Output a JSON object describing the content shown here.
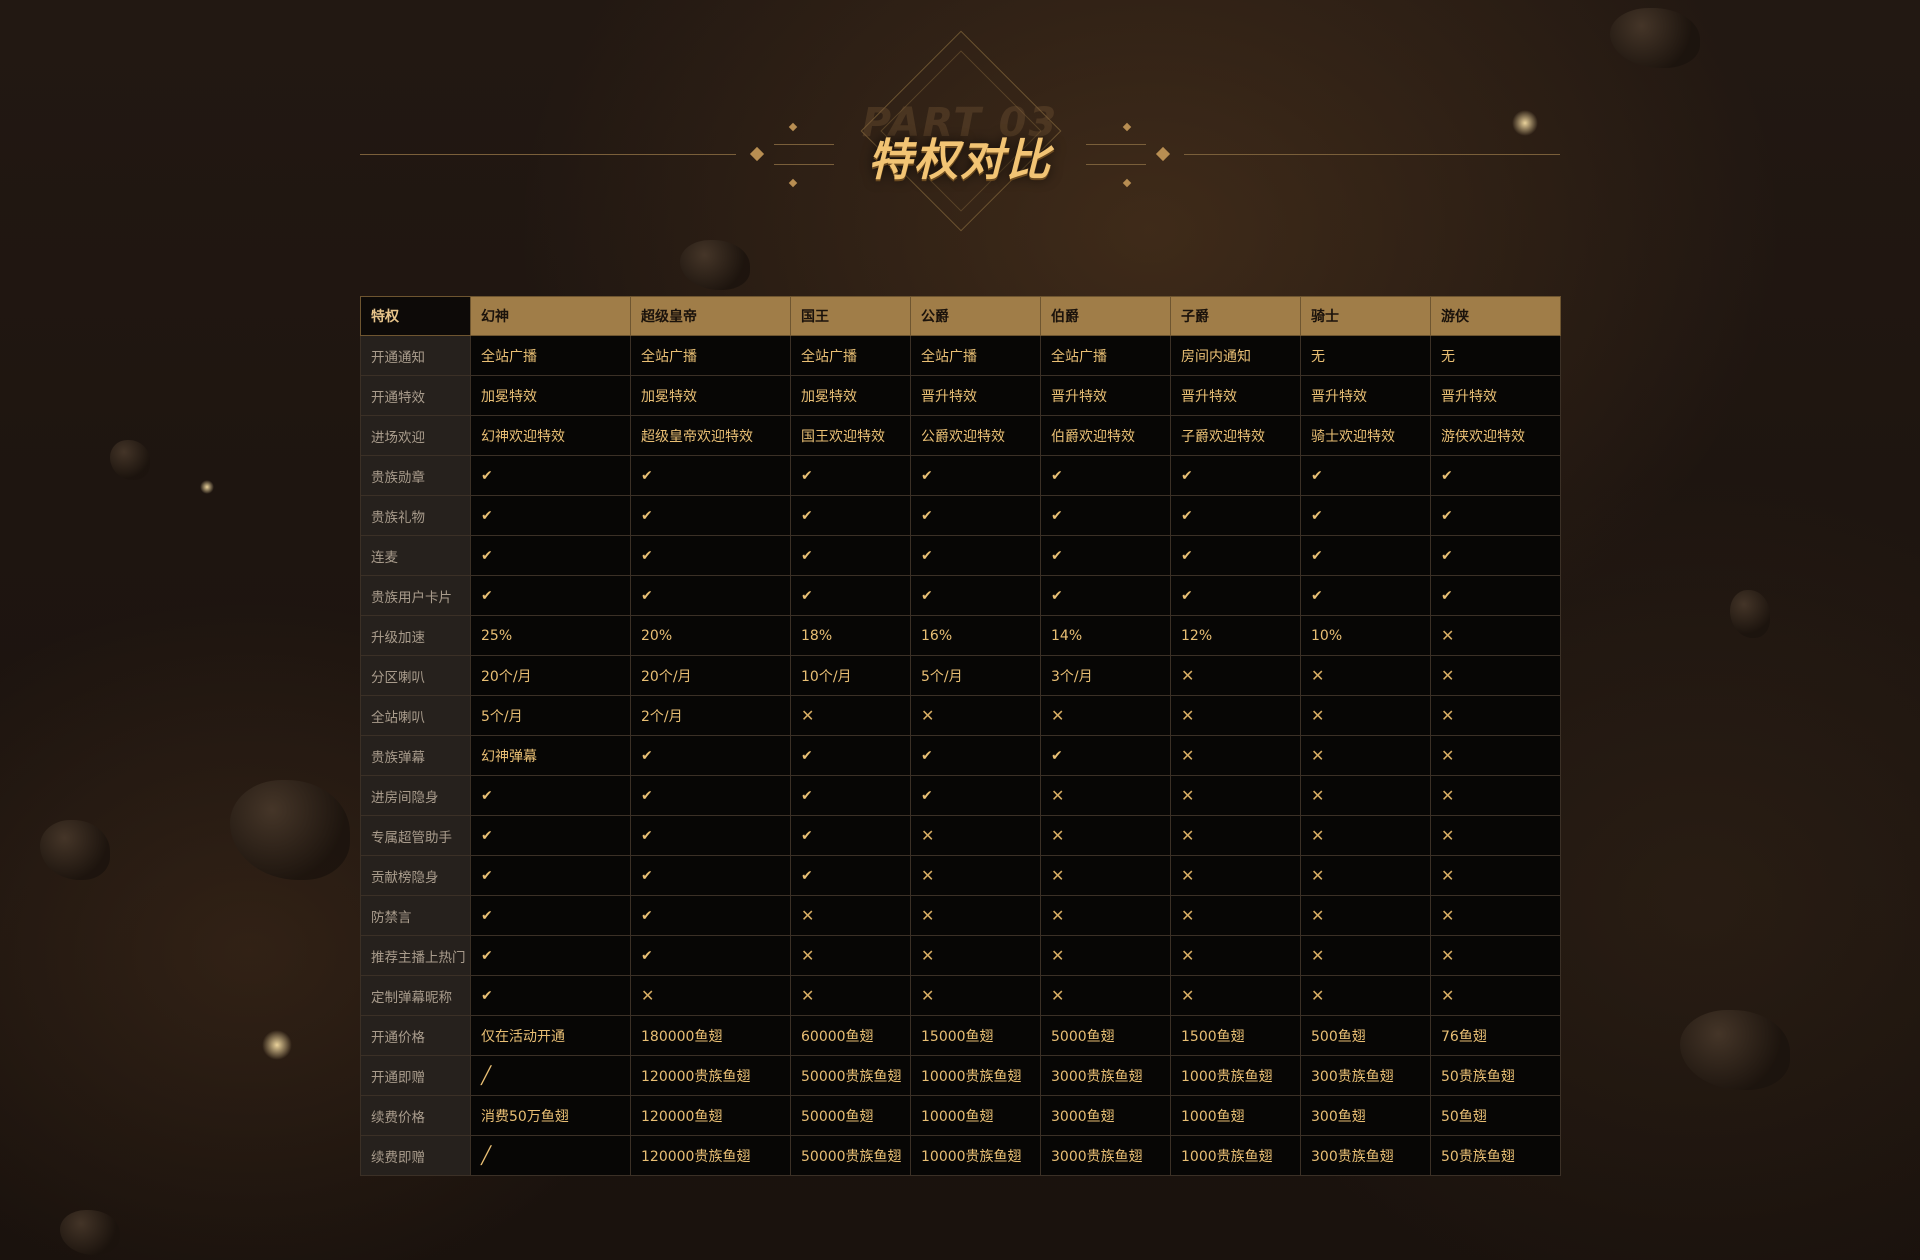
{
  "header": {
    "part_label": "PART 03",
    "title": "特权对比"
  },
  "table": {
    "corner": "特权",
    "columns": [
      "幻神",
      "超级皇帝",
      "国王",
      "公爵",
      "伯爵",
      "子爵",
      "骑士",
      "游侠"
    ],
    "rows": [
      {
        "label": "开通通知",
        "cells": [
          "全站广播",
          "全站广播",
          "全站广播",
          "全站广播",
          "全站广播",
          "房间内通知",
          "无",
          "无"
        ]
      },
      {
        "label": "开通特效",
        "cells": [
          "加冕特效",
          "加冕特效",
          "加冕特效",
          "晋升特效",
          "晋升特效",
          "晋升特效",
          "晋升特效",
          "晋升特效"
        ]
      },
      {
        "label": "进场欢迎",
        "cells": [
          "幻神欢迎特效",
          "超级皇帝欢迎特效",
          "国王欢迎特效",
          "公爵欢迎特效",
          "伯爵欢迎特效",
          "子爵欢迎特效",
          "骑士欢迎特效",
          "游侠欢迎特效"
        ]
      },
      {
        "label": "贵族勋章",
        "cells": [
          "✔",
          "✔",
          "✔",
          "✔",
          "✔",
          "✔",
          "✔",
          "✔"
        ]
      },
      {
        "label": "贵族礼物",
        "cells": [
          "✔",
          "✔",
          "✔",
          "✔",
          "✔",
          "✔",
          "✔",
          "✔"
        ]
      },
      {
        "label": "连麦",
        "cells": [
          "✔",
          "✔",
          "✔",
          "✔",
          "✔",
          "✔",
          "✔",
          "✔"
        ]
      },
      {
        "label": "贵族用户卡片",
        "cells": [
          "✔",
          "✔",
          "✔",
          "✔",
          "✔",
          "✔",
          "✔",
          "✔"
        ]
      },
      {
        "label": "升级加速",
        "cells": [
          "25%",
          "20%",
          "18%",
          "16%",
          "14%",
          "12%",
          "10%",
          "✕"
        ]
      },
      {
        "label": "分区喇叭",
        "cells": [
          "20个/月",
          "20个/月",
          "10个/月",
          "5个/月",
          "3个/月",
          "✕",
          "✕",
          "✕"
        ]
      },
      {
        "label": "全站喇叭",
        "cells": [
          "5个/月",
          "2个/月",
          "✕",
          "✕",
          "✕",
          "✕",
          "✕",
          "✕"
        ]
      },
      {
        "label": "贵族弹幕",
        "cells": [
          "幻神弹幕",
          "✔",
          "✔",
          "✔",
          "✔",
          "✕",
          "✕",
          "✕"
        ]
      },
      {
        "label": "进房间隐身",
        "cells": [
          "✔",
          "✔",
          "✔",
          "✔",
          "✕",
          "✕",
          "✕",
          "✕"
        ]
      },
      {
        "label": "专属超管助手",
        "cells": [
          "✔",
          "✔",
          "✔",
          "✕",
          "✕",
          "✕",
          "✕",
          "✕"
        ]
      },
      {
        "label": "贡献榜隐身",
        "cells": [
          "✔",
          "✔",
          "✔",
          "✕",
          "✕",
          "✕",
          "✕",
          "✕"
        ]
      },
      {
        "label": "防禁言",
        "cells": [
          "✔",
          "✔",
          "✕",
          "✕",
          "✕",
          "✕",
          "✕",
          "✕"
        ]
      },
      {
        "label": "推荐主播上热门",
        "cells": [
          "✔",
          "✔",
          "✕",
          "✕",
          "✕",
          "✕",
          "✕",
          "✕"
        ]
      },
      {
        "label": "定制弹幕昵称",
        "cells": [
          "✔",
          "✕",
          "✕",
          "✕",
          "✕",
          "✕",
          "✕",
          "✕"
        ]
      },
      {
        "label": "开通价格",
        "cells": [
          "仅在活动开通",
          "180000鱼翅",
          "60000鱼翅",
          "15000鱼翅",
          "5000鱼翅",
          "1500鱼翅",
          "500鱼翅",
          "76鱼翅"
        ]
      },
      {
        "label": "开通即赠",
        "cells": [
          "╱",
          "120000贵族鱼翅",
          "50000贵族鱼翅",
          "10000贵族鱼翅",
          "3000贵族鱼翅",
          "1000贵族鱼翅",
          "300贵族鱼翅",
          "50贵族鱼翅"
        ]
      },
      {
        "label": "续费价格",
        "cells": [
          "消费50万鱼翅",
          "120000鱼翅",
          "50000鱼翅",
          "10000鱼翅",
          "3000鱼翅",
          "1000鱼翅",
          "300鱼翅",
          "50鱼翅"
        ]
      },
      {
        "label": "续费即赠",
        "cells": [
          "╱",
          "120000贵族鱼翅",
          "50000贵族鱼翅",
          "10000贵族鱼翅",
          "3000贵族鱼翅",
          "1000贵族鱼翅",
          "300贵族鱼翅",
          "50贵族鱼翅"
        ]
      }
    ]
  },
  "colors": {
    "header_gold": "#a07d48",
    "text_gold": "#e9bf74",
    "row_label_bg": "#26211d",
    "cell_bg": "#070605"
  },
  "icons": {
    "✔": "check-icon",
    "✕": "cross-icon",
    "╱": "slash-icon"
  }
}
